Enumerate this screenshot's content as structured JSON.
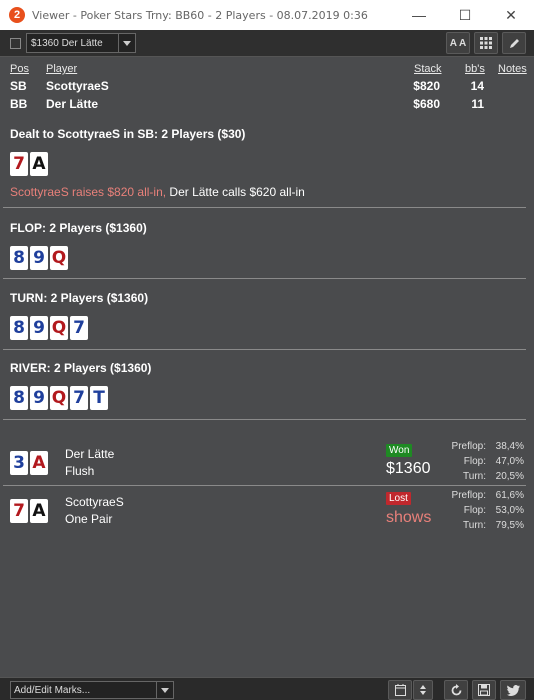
{
  "window": {
    "title": "Viewer - Poker Stars Trny: BB60 - 2 Players - 08.07.2019 0:36",
    "app_icon_glyph": "2",
    "minimize_glyph": "—",
    "maximize_glyph": "☐",
    "close_glyph": "✕"
  },
  "toolbar": {
    "hand_select_value": "$1360 Der Lätte",
    "font_button_label": "A A",
    "grid_icon": "grid-icon",
    "edit_icon": "pencil-icon"
  },
  "players_table": {
    "headers": {
      "pos": "Pos",
      "player": "Player",
      "stack": "Stack",
      "bbs": "bb's",
      "notes": "Notes"
    },
    "rows": [
      {
        "pos": "SB",
        "player": "ScottyraeS",
        "stack": "$820",
        "bbs": "14"
      },
      {
        "pos": "BB",
        "player": "Der Lätte",
        "stack": "$680",
        "bbs": "11"
      }
    ]
  },
  "preflop": {
    "title": "Dealt to ScottyraeS in SB: 2 Players ($30)",
    "cards": [
      {
        "rank": "7",
        "color": "red"
      },
      {
        "rank": "A",
        "color": "black"
      }
    ],
    "action_1": "ScottyraeS raises $820 all-in,",
    "action_2": " Der Lätte calls $620 all-in"
  },
  "flop": {
    "title": "FLOP: 2 Players ($1360)",
    "cards": [
      {
        "rank": "8",
        "color": "blue"
      },
      {
        "rank": "9",
        "color": "blue"
      },
      {
        "rank": "Q",
        "color": "red"
      }
    ]
  },
  "turn": {
    "title": "TURN: 2 Players ($1360)",
    "cards": [
      {
        "rank": "8",
        "color": "blue"
      },
      {
        "rank": "9",
        "color": "blue"
      },
      {
        "rank": "Q",
        "color": "red"
      },
      {
        "rank": "7",
        "color": "blue"
      }
    ]
  },
  "river": {
    "title": "RIVER: 2 Players ($1360)",
    "cards": [
      {
        "rank": "8",
        "color": "blue"
      },
      {
        "rank": "9",
        "color": "blue"
      },
      {
        "rank": "Q",
        "color": "red"
      },
      {
        "rank": "7",
        "color": "blue"
      },
      {
        "rank": "T",
        "color": "blue"
      }
    ]
  },
  "results": [
    {
      "player": "Der Lätte",
      "hand": "Flush",
      "cards": [
        {
          "rank": "3",
          "color": "blue"
        },
        {
          "rank": "A",
          "color": "red"
        }
      ],
      "badge": "Won",
      "amount": "$1360",
      "stats": [
        {
          "label": "Preflop:",
          "value": "38,4%"
        },
        {
          "label": "Flop:",
          "value": "47,0%"
        },
        {
          "label": "Turn:",
          "value": "20,5%"
        }
      ]
    },
    {
      "player": "ScottyraeS",
      "hand": "One Pair",
      "cards": [
        {
          "rank": "7",
          "color": "red"
        },
        {
          "rank": "A",
          "color": "black"
        }
      ],
      "badge": "Lost",
      "amount": "shows",
      "stats": [
        {
          "label": "Preflop:",
          "value": "61,6%"
        },
        {
          "label": "Flop:",
          "value": "53,0%"
        },
        {
          "label": "Turn:",
          "value": "79,5%"
        }
      ]
    }
  ],
  "bottom": {
    "marks_placeholder": "Add/Edit Marks..."
  },
  "colors": {
    "card_red": "#b2191e",
    "card_blue": "#1f3f9c",
    "card_black": "#111111",
    "won_badge": "#1e8a23",
    "lost_badge": "#c0282d",
    "lost_text": "#e8807a",
    "app_icon": "#e8501c"
  }
}
